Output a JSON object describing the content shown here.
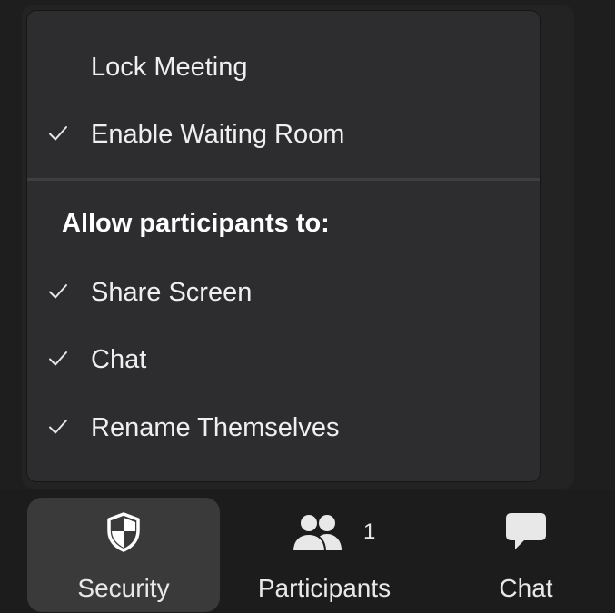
{
  "menu": {
    "items": [
      {
        "label": "Lock Meeting",
        "checked": false
      },
      {
        "label": "Enable Waiting Room",
        "checked": true
      }
    ],
    "section_header": "Allow participants to:",
    "allow_items": [
      {
        "label": "Share Screen",
        "checked": true
      },
      {
        "label": "Chat",
        "checked": true
      },
      {
        "label": "Rename Themselves",
        "checked": true
      }
    ]
  },
  "toolbar": {
    "security": {
      "label": "Security",
      "icon": "shield-icon",
      "active": true
    },
    "participants": {
      "label": "Participants",
      "icon": "participants-icon",
      "count": "1"
    },
    "chat": {
      "label": "Chat",
      "icon": "chat-bubble-icon"
    }
  },
  "colors": {
    "menu_bg": "#2d2d2f",
    "toolbar_bg": "#1c1c1c",
    "active_button_bg": "#3a3a3a",
    "text": "#efefef"
  }
}
